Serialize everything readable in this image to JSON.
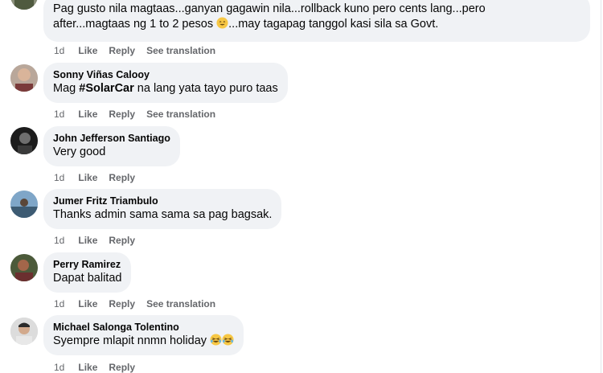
{
  "comments": [
    {
      "lines": [
        "Pag gusto nila magtaas...ganyan gagawin nila...rollback kuno pero cents lang...pero",
        "after...magtaas ng 1 to 2 pesos",
        "...may tagapag tanggol kasi sila sa Govt."
      ],
      "emoji": "smiling-face-emoji",
      "time": "1d",
      "like": "Like",
      "reply": "Reply",
      "translate": "See translation"
    },
    {
      "name": "Sonny Viñas Calooy",
      "text_before": "Mag ",
      "hashtag": "#SolarCar",
      "text_after": " na lang yata tayo puro taas",
      "time": "1d",
      "like": "Like",
      "reply": "Reply",
      "translate": "See translation"
    },
    {
      "name": "John Jefferson Santiago",
      "text": "Very good",
      "time": "1d",
      "like": "Like",
      "reply": "Reply"
    },
    {
      "name": "Jumer Fritz Triambulo",
      "text": "Thanks admin sama sama sa pag bagsak.",
      "time": "1d",
      "like": "Like",
      "reply": "Reply"
    },
    {
      "name": "Perry Ramirez",
      "text": "Dapat balitad",
      "time": "1d",
      "like": "Like",
      "reply": "Reply",
      "translate": "See translation"
    },
    {
      "name": "Michael Salonga Tolentino",
      "text": "Syempre mlapit nnmn holiday",
      "emoji": "rolling-laughing-emoji",
      "time": "1d",
      "like": "Like",
      "reply": "Reply"
    }
  ],
  "colors": {
    "bubble": "#f0f2f5",
    "meta": "#65676b",
    "text": "#050505"
  }
}
